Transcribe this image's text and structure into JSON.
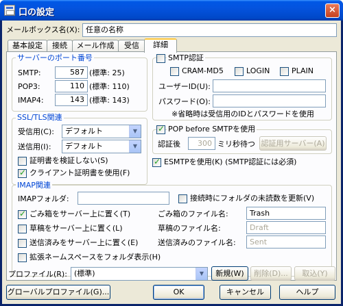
{
  "window": {
    "title": "口の設定",
    "close_glyph": "×"
  },
  "mailbox": {
    "label": "メールボックス名(X):",
    "value": "任意の名称"
  },
  "tabs": [
    {
      "label": "基本設定"
    },
    {
      "label": "接続"
    },
    {
      "label": "メール作成"
    },
    {
      "label": "受信"
    },
    {
      "label": "詳細"
    }
  ],
  "server_ports": {
    "title": "サーバーのポート番号",
    "rows": [
      {
        "label": "SMTP:",
        "value": "587",
        "default": "(標準: 25)"
      },
      {
        "label": "POP3:",
        "value": "110",
        "default": "(標準: 110)"
      },
      {
        "label": "IMAP4:",
        "value": "143",
        "default": "(標準: 143)"
      }
    ]
  },
  "ssl": {
    "title": "SSL/TLS関連",
    "receive_label": "受信用(C):",
    "receive_value": "デフォルト",
    "send_label": "送信用(I):",
    "send_value": "デフォルト",
    "verify_cert": "証明書を検証しない(S)",
    "client_cert": "クライアント証明書を使用(F)"
  },
  "smtp_auth": {
    "title": "SMTP認証",
    "cram": "CRAM-MD5",
    "login": "LOGIN",
    "plain": "PLAIN",
    "user_label": "ユーザーID(U):",
    "password_label": "パスワード(O):",
    "note": "※省略時は受信用のIDとパスワードを使用"
  },
  "pop_before": {
    "title": "POP before SMTPを使用",
    "wait_label": "認証後",
    "wait_value": "300",
    "wait_unit": "ミリ秒待つ",
    "server_button": "認証用サーバー(A)"
  },
  "esmtp": {
    "label": "ESMTPを使用(K) (SMTP認証には必須)"
  },
  "imap": {
    "title": "IMAP関連",
    "folder_label": "IMAPフォルダ:",
    "update_unread": "接続時にフォルダの未読数を更新(V)",
    "trash_on_server": "ごみ箱をサーバー上に置く(T)",
    "drafts_on_server": "草稿をサーバー上に置く(L)",
    "sent_on_server": "送信済みをサーバー上に置く(E)",
    "namespace": "拡張ネームスペースをフォルダ表示(H)",
    "trash_label": "ごみ箱のファイル名:",
    "trash_value": "Trash",
    "drafts_label": "草稿のファイル名:",
    "drafts_value": "Draft",
    "sent_label": "送信済みのファイル名:",
    "sent_value": "Sent"
  },
  "profile": {
    "label": "プロファイル(R):",
    "value": "(標準)",
    "new_button": "新規(W)",
    "delete_button": "削除(D)...",
    "cancel_button": "取込(Y)"
  },
  "footer": {
    "global_profile": "グローバルプロファイル(G)...",
    "ok": "OK",
    "cancel": "キャンセル",
    "help": "ヘルプ"
  }
}
